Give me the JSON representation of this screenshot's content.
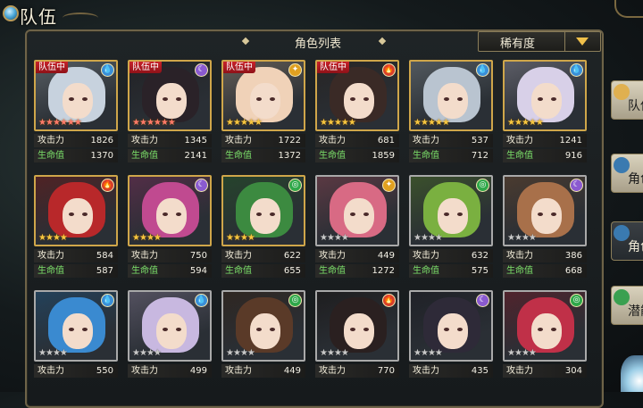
{
  "header": {
    "title": "队伍"
  },
  "panel": {
    "title": "角色列表"
  },
  "sort": {
    "label": "稀有度"
  },
  "stat_labels": {
    "atk": "攻击力",
    "hp": "生命值"
  },
  "team_tag": "队伍中",
  "element_icons": {
    "water": {
      "glyph": "💧",
      "color": "#3a8fd8"
    },
    "moon": {
      "glyph": "☾",
      "color": "#8a5ad0"
    },
    "light": {
      "glyph": "✦",
      "color": "#e0a020"
    },
    "fire": {
      "glyph": "🔥",
      "color": "#d8402a"
    },
    "wind": {
      "glyph": "◎",
      "color": "#2fa84a"
    }
  },
  "characters": [
    {
      "name_icon": "silver-hair-elf",
      "element": "water",
      "in_team": true,
      "stars": 6,
      "star_style": "red",
      "frame": "gold",
      "hair": "#c7d2de",
      "atk": "1826",
      "hp": "1370"
    },
    {
      "name_icon": "black-hair-girl",
      "element": "moon",
      "in_team": true,
      "stars": 6,
      "star_style": "red",
      "frame": "gold",
      "hair": "#2a2228",
      "atk": "1345",
      "hp": "2141"
    },
    {
      "name_icon": "blonde-girl",
      "element": "light",
      "in_team": true,
      "stars": 5,
      "star_style": "gold",
      "frame": "gold",
      "hair": "#f0d2b8",
      "atk": "1722",
      "hp": "1372"
    },
    {
      "name_icon": "dark-hair-fire-girl",
      "element": "fire",
      "in_team": true,
      "stars": 5,
      "star_style": "gold",
      "frame": "gold",
      "hair": "#3a2a26",
      "atk": "681",
      "hp": "1859"
    },
    {
      "name_icon": "silver-hair-swordsman",
      "element": "water",
      "in_team": false,
      "stars": 5,
      "star_style": "gold",
      "frame": "gold",
      "hair": "#b9c4d0",
      "atk": "537",
      "hp": "712"
    },
    {
      "name_icon": "lavender-hair-elf",
      "element": "water",
      "in_team": false,
      "stars": 5,
      "star_style": "gold",
      "frame": "gold",
      "hair": "#d8d0e8",
      "atk": "1241",
      "hp": "916"
    },
    {
      "name_icon": "red-hair-elf",
      "element": "fire",
      "in_team": false,
      "stars": 4,
      "star_style": "gold",
      "frame": "gold",
      "hair": "#b8282a",
      "atk": "584",
      "hp": "587"
    },
    {
      "name_icon": "pink-hair-woman",
      "element": "moon",
      "in_team": false,
      "stars": 4,
      "star_style": "gold",
      "frame": "gold",
      "hair": "#c04a90",
      "atk": "750",
      "hp": "594"
    },
    {
      "name_icon": "green-hair-elf",
      "element": "wind",
      "in_team": false,
      "stars": 4,
      "star_style": "gold",
      "frame": "gold",
      "hair": "#3c8a40",
      "atk": "622",
      "hp": "655"
    },
    {
      "name_icon": "pink-hair-glasses-girl",
      "element": "light",
      "in_team": false,
      "stars": 4,
      "star_style": "silver",
      "frame": "silver",
      "hair": "#d86a84",
      "atk": "449",
      "hp": "1272"
    },
    {
      "name_icon": "green-hair-fairy",
      "element": "wind",
      "in_team": false,
      "stars": 4,
      "star_style": "silver",
      "frame": "silver",
      "hair": "#7ab040",
      "atk": "632",
      "hp": "575"
    },
    {
      "name_icon": "brown-hair-girl",
      "element": "moon",
      "in_team": false,
      "stars": 4,
      "star_style": "silver",
      "frame": "silver",
      "hair": "#a8704a",
      "atk": "386",
      "hp": "668"
    },
    {
      "name_icon": "blue-hair-girl",
      "element": "water",
      "in_team": false,
      "stars": 4,
      "star_style": "silver",
      "frame": "silver",
      "hair": "#3a8ad0",
      "atk": "550",
      "hp": ""
    },
    {
      "name_icon": "lilac-hair-maid",
      "element": "water",
      "in_team": false,
      "stars": 4,
      "star_style": "silver",
      "frame": "silver",
      "hair": "#c8b8e0",
      "atk": "499",
      "hp": ""
    },
    {
      "name_icon": "brown-hair-man",
      "element": "wind",
      "in_team": false,
      "stars": 4,
      "star_style": "silver",
      "frame": "silver",
      "hair": "#5a3a28",
      "atk": "449",
      "hp": ""
    },
    {
      "name_icon": "dark-hair-boy",
      "element": "fire",
      "in_team": false,
      "stars": 4,
      "star_style": "silver",
      "frame": "silver",
      "hair": "#2a2020",
      "atk": "770",
      "hp": ""
    },
    {
      "name_icon": "dark-hair-elf-girl",
      "element": "moon",
      "in_team": false,
      "stars": 4,
      "star_style": "silver",
      "frame": "silver",
      "hair": "#2e2a38",
      "atk": "435",
      "hp": ""
    },
    {
      "name_icon": "red-hair-girl",
      "element": "wind",
      "in_team": false,
      "stars": 4,
      "star_style": "silver",
      "frame": "silver",
      "hair": "#c03048",
      "atk": "304",
      "hp": ""
    }
  ],
  "side_nav": [
    {
      "label": "队伍",
      "icon_color": "#e0b050"
    },
    {
      "label": "角色",
      "icon_color": "#3a7ab0"
    },
    {
      "label": "角色",
      "icon_color": "#3a7ab0"
    },
    {
      "label": "潜能",
      "icon_color": "#3aa050"
    }
  ]
}
